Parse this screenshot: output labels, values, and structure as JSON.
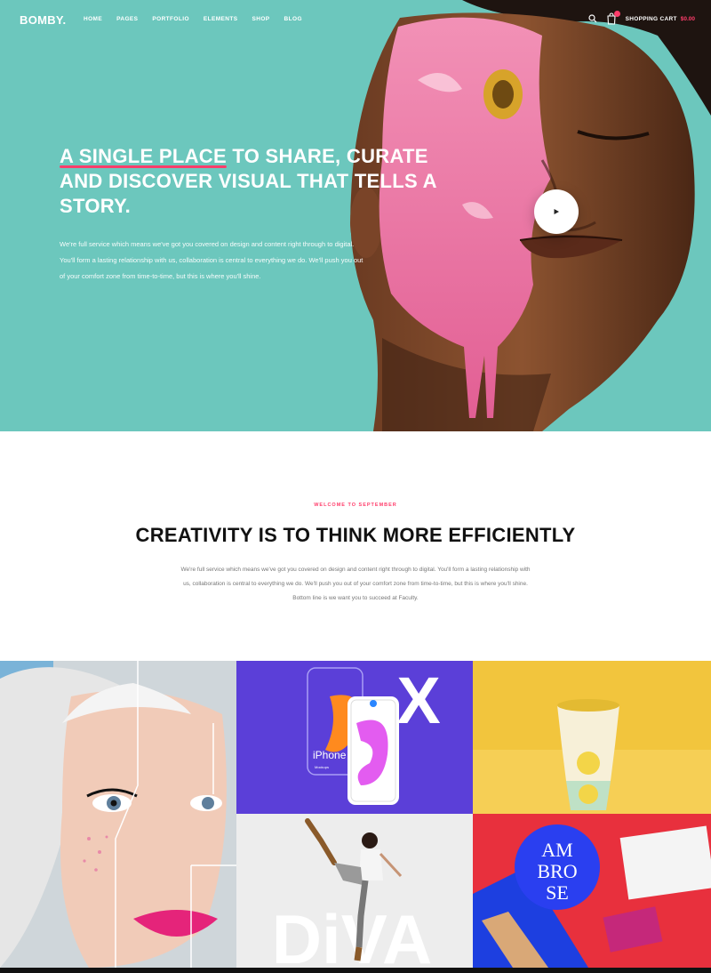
{
  "brand": {
    "logo": "BOMBY."
  },
  "nav": {
    "items": [
      "HOME",
      "PAGES",
      "PORTFOLIO",
      "ELEMENTS",
      "SHOP",
      "BLOG"
    ],
    "cart_label": "SHOPPING CART",
    "cart_price": "$0.00"
  },
  "hero": {
    "title_highlight": "A SINGLE PLACE",
    "title_rest_line1": " TO SHARE, CURATE",
    "title_line2": "AND DISCOVER VISUAL THAT TELLS A",
    "title_line3": "STORY.",
    "body_line1": "We're full service which means we've got you covered on design and content right through to digital.",
    "body_line2": "You'll form a lasting relationship with us, collaboration is central to everything we do. We'll push you out",
    "body_line3": "of your comfort zone from time-to-time, but this is where you'll shine."
  },
  "intro": {
    "eyebrow": "WELCOME TO SEPTEMBER",
    "title": "CREATIVITY IS TO THINK MORE EFFICIENTLY",
    "body_line1": "We're full service which means we've got you covered on design and content right through to digital. You'll form a lasting relationship with",
    "body_line2": "us, collaboration is central to everything we do. We'll push you out of your comfort zone from time-to-time, but this is where you'll shine.",
    "body_line3": "Bottom line is we want you to succeed at Faculty."
  },
  "gallery": {
    "iphone_label": "iPhone X",
    "iphone_sub": "Mockups",
    "x_letter": "X",
    "diva_word": "DiVA",
    "ambrose": [
      "AM",
      "BRO",
      "SE"
    ]
  },
  "colors": {
    "accent": "#ff3d6b",
    "hero_bg": "#6cc7bd",
    "gallery_purple": "#5b3fd8",
    "gallery_yellow": "#f2c53d",
    "gallery_red": "#e8303d"
  }
}
